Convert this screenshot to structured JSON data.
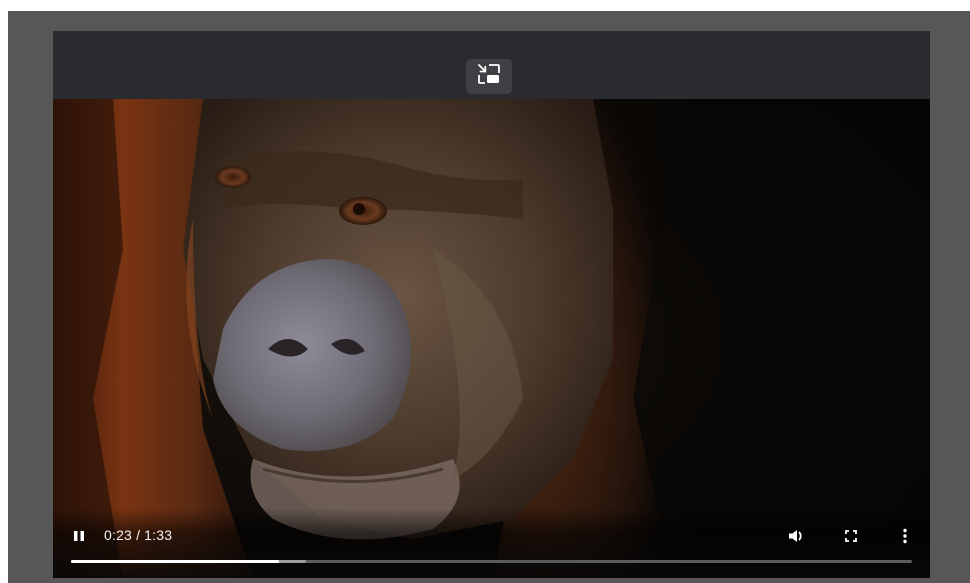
{
  "player": {
    "pip_button_icon": "picture-in-picture-exit-icon",
    "video_subject": "",
    "controls": {
      "play_icon": "pause-icon",
      "current_time": "0:23",
      "time_separator": "/",
      "duration": "1:33",
      "volume_icon": "volume-icon",
      "fullscreen_icon": "fullscreen-icon",
      "more_icon": "more-vertical-icon",
      "progress_played_fraction": 0.247,
      "progress_buffered_fraction": 0.28
    }
  },
  "colors": {
    "frame_bg": "#575757",
    "player_bg": "#2a2b2e",
    "progress_played": "#ffffff",
    "progress_buffered": "#9c9d9f",
    "progress_track": "#5b5c5e"
  }
}
